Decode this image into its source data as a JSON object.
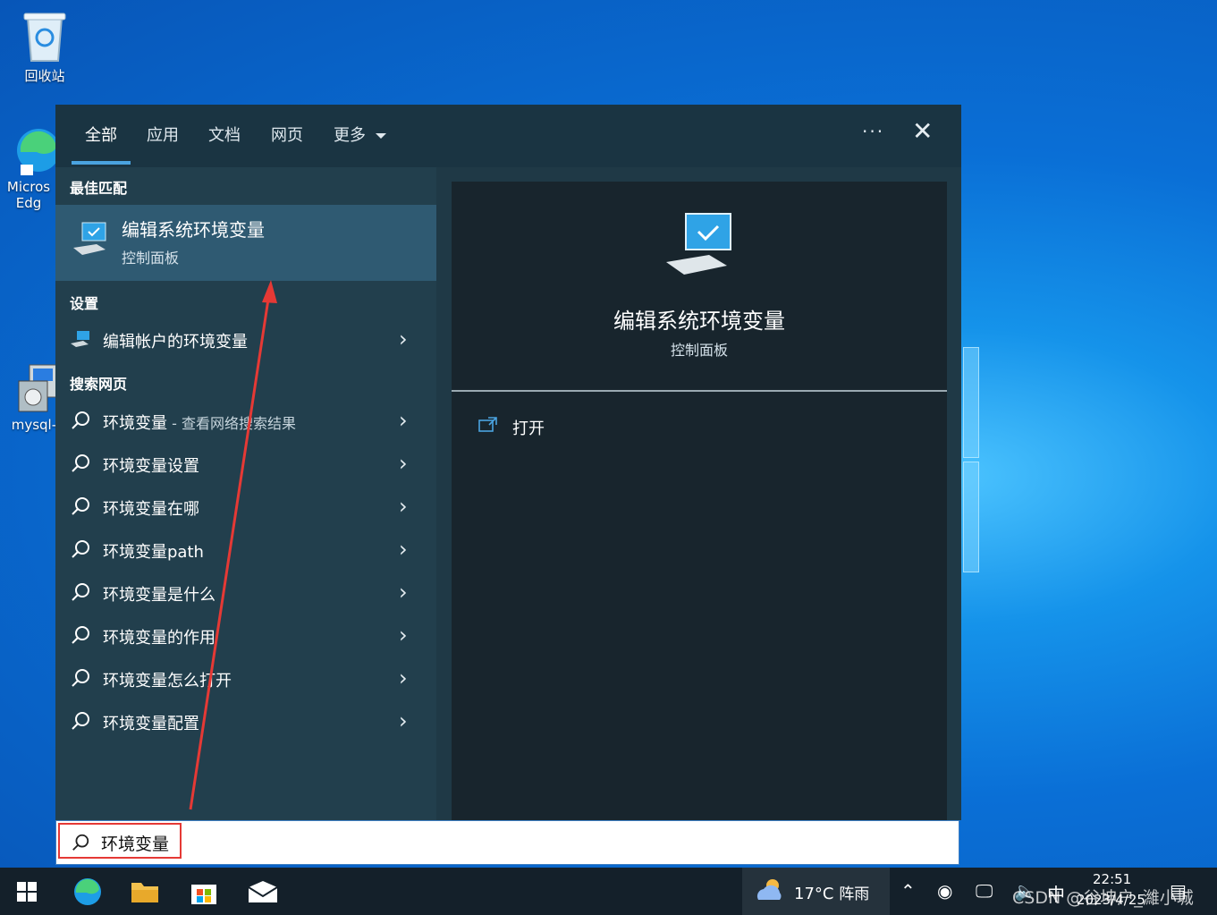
{
  "desktop": {
    "icons": [
      {
        "label": "回收站"
      },
      {
        "label": "Micros Edg"
      },
      {
        "label": "mysql-i"
      }
    ]
  },
  "search_panel": {
    "tabs": [
      "全部",
      "应用",
      "文档",
      "网页",
      "更多"
    ],
    "more_dots": "···",
    "close_glyph": "✕",
    "best_match": {
      "header": "最佳匹配",
      "title": "编辑系统环境变量",
      "subtitle": "控制面板",
      "icon": "monitor-check-icon"
    },
    "settings": {
      "header": "设置",
      "items": [
        {
          "label": "编辑帐户的环境变量"
        }
      ]
    },
    "web": {
      "header": "搜索网页",
      "first": {
        "label": "环境变量",
        "suffix": " - 查看网络搜索结果"
      },
      "items": [
        {
          "label": "环境变量设置"
        },
        {
          "label": "环境变量在哪"
        },
        {
          "label": "环境变量path"
        },
        {
          "label": "环境变量是什么"
        },
        {
          "label": "环境变量的作用"
        },
        {
          "label": "环境变量怎么打开"
        },
        {
          "label": "环境变量配置"
        }
      ]
    },
    "preview": {
      "title": "编辑系统环境变量",
      "subtitle": "控制面板",
      "actions": [
        {
          "label": "打开",
          "icon": "open-icon"
        }
      ]
    }
  },
  "search_box": {
    "value": "环境变量"
  },
  "taskbar": {
    "weather": {
      "temp": "17°C",
      "condition": "阵雨"
    },
    "ime": "中",
    "time": "22:51",
    "date": "2023/4/25",
    "watermark": "CSDN @谷坤户_濰小城"
  },
  "colors": {
    "annotation": "#e53935",
    "accent": "#4aa3e0",
    "highlight_row": "#2f5a72"
  }
}
